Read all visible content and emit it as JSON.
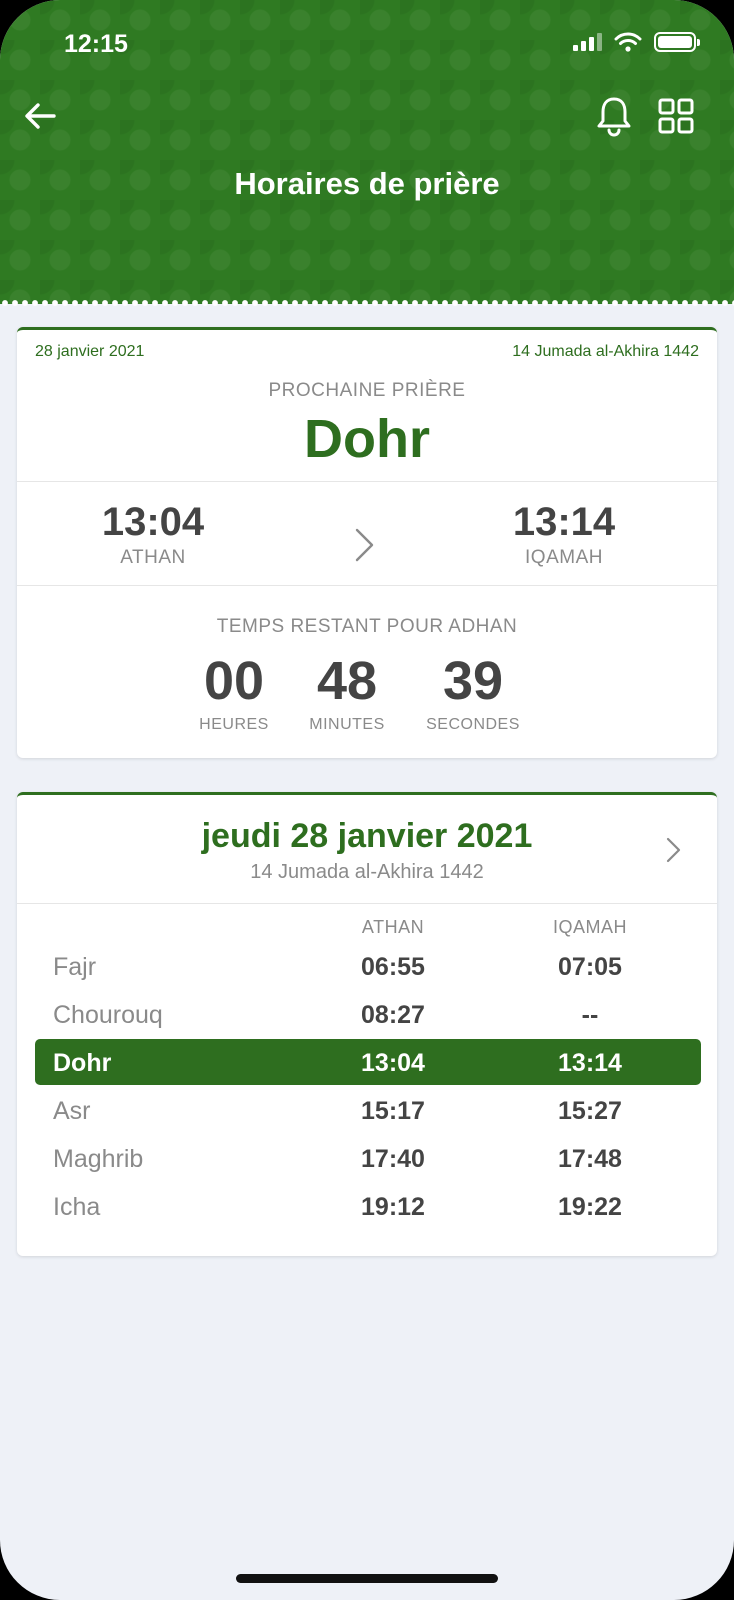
{
  "status": {
    "time": "12:15"
  },
  "header": {
    "title": "Horaires de prière"
  },
  "next_prayer": {
    "date": "28 janvier 2021",
    "hijri_date": "14 Jumada al-Akhira 1442",
    "label": "PROCHAINE PRIÈRE",
    "name": "Dohr",
    "athan_time": "13:04",
    "athan_label": "ATHAN",
    "iqamah_time": "13:14",
    "iqamah_label": "IQAMAH",
    "remaining_label": "TEMPS RESTANT POUR ADHAN",
    "hours": "00",
    "hours_label": "HEURES",
    "minutes": "48",
    "minutes_label": "MINUTES",
    "seconds": "39",
    "seconds_label": "SECONDES"
  },
  "schedule": {
    "day_title": "jeudi 28 janvier 2021",
    "hijri": "14 Jumada al-Akhira 1442",
    "col_athan": "ATHAN",
    "col_iqamah": "IQAMAH",
    "rows": [
      {
        "name": "Fajr",
        "athan": "06:55",
        "iqamah": "07:05"
      },
      {
        "name": "Chourouq",
        "athan": "08:27",
        "iqamah": "--"
      },
      {
        "name": "Dohr",
        "athan": "13:04",
        "iqamah": "13:14"
      },
      {
        "name": "Asr",
        "athan": "15:17",
        "iqamah": "15:27"
      },
      {
        "name": "Maghrib",
        "athan": "17:40",
        "iqamah": "17:48"
      },
      {
        "name": "Icha",
        "athan": "19:12",
        "iqamah": "19:22"
      }
    ],
    "active_index": 2
  },
  "colors": {
    "primary_green": "#2e6e1f",
    "header_green": "#2f7a22",
    "background": "#eef1f7"
  }
}
